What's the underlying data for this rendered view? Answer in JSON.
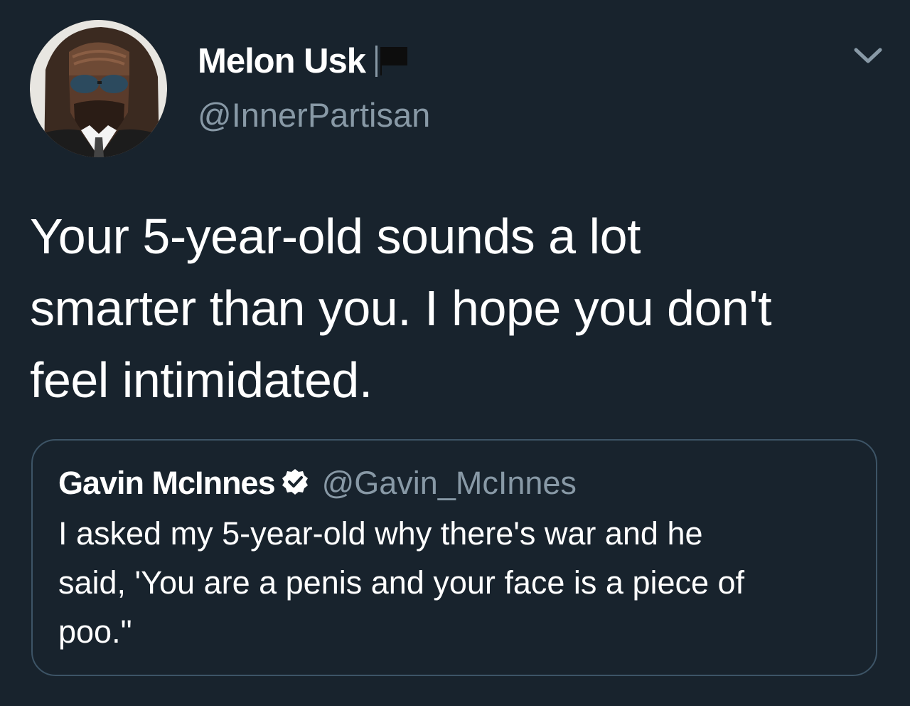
{
  "tweet": {
    "display_name": "Melon Usk",
    "handle": "@InnerPartisan",
    "avatar_icon": "avatar-photo",
    "flag_icon": "black-flag-icon",
    "menu_icon": "chevron-down-icon",
    "text_lines": [
      "Your 5-year-old sounds a lot",
      "smarter than you. I hope you don't",
      "feel intimidated."
    ]
  },
  "quoted_tweet": {
    "display_name": "Gavin McInnes",
    "verified_icon": "verified-badge-icon",
    "handle": "@Gavin_McInnes",
    "text_lines": [
      "I asked my 5-year-old why there's war and he",
      "said, 'You are a penis and your face is a piece of",
      "poo.\""
    ]
  },
  "colors": {
    "background": "#18232d",
    "primary_text": "#ffffff",
    "secondary_text": "#8899a6",
    "border": "#3d5466"
  }
}
